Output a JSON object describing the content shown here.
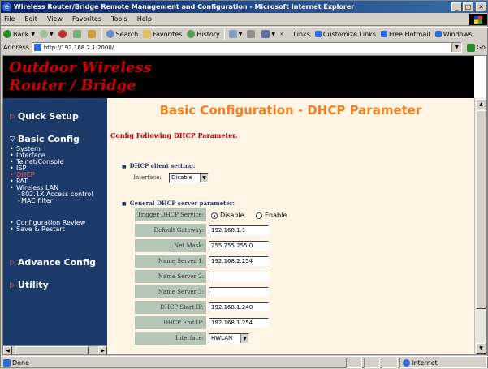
{
  "window": {
    "title": "Wireless Router/Bridge Remote Management and Configuration - Microsoft Internet Explorer",
    "logo_letter": "e",
    "min": "_",
    "max": "□",
    "close": "×"
  },
  "menubar": [
    "File",
    "Edit",
    "View",
    "Favorites",
    "Tools",
    "Help"
  ],
  "toolbar": {
    "back": "Back",
    "search": "Search",
    "favorites": "Favorites",
    "history": "History",
    "links_label": "Links",
    "links": [
      "Customize Links",
      "Free Hotmail",
      "Windows"
    ]
  },
  "address": {
    "label": "Address",
    "url": "http://192.168.2.1:2000/",
    "go": "Go"
  },
  "banner": {
    "line1": "Outdoor Wireless",
    "line2": "Router / Bridge"
  },
  "sidebar": {
    "quick_setup": "Quick Setup",
    "basic_config": "Basic Config",
    "basic_items": [
      "System",
      "Interface",
      "Telnet/Console",
      "ISP",
      "DHCP",
      "PAT",
      "Wireless LAN"
    ],
    "wlan_sub": [
      "802.1X Access control",
      "MAC filter"
    ],
    "review_items": [
      "Configuration Review",
      "Save & Restart"
    ],
    "advance_config": "Advance Config",
    "utility": "Utility"
  },
  "main": {
    "title": "Basic Configuration - DHCP Parameter",
    "subtitle": "Config Following DHCP Parameter.",
    "client_section": "DHCP client setting:",
    "client_interface_label": "Interface:",
    "client_interface_value": "Disable",
    "server_section": "General DHCP server parameter:",
    "rows": {
      "trigger_label": "Trigger DHCP Service:",
      "trigger_options": [
        "Disable",
        "Enable"
      ],
      "trigger_selected": "Disable",
      "gateway_label": "Default Gateway:",
      "gateway": "192.168.1.1",
      "netmask_label": "Net Mask:",
      "netmask": "255.255.255.0",
      "ns1_label": "Name Server 1:",
      "ns1": "192.168.2.254",
      "ns2_label": "Name Server 2:",
      "ns2": "",
      "ns3_label": "Name Server 3:",
      "ns3": "",
      "start_label": "DHCP Start IP:",
      "start": "192.168.1.240",
      "end_label": "DHCP End IP:",
      "end": "192.168.1.254",
      "iface_label": "Interface:",
      "iface": "HWLAN"
    }
  },
  "status": {
    "text": "Done",
    "zone": "Internet"
  },
  "colors": {
    "title_orange": "#f08020",
    "nav_blue": "#1c3a6a",
    "brand_red": "#c00000",
    "label_green": "#b6c6b6"
  }
}
